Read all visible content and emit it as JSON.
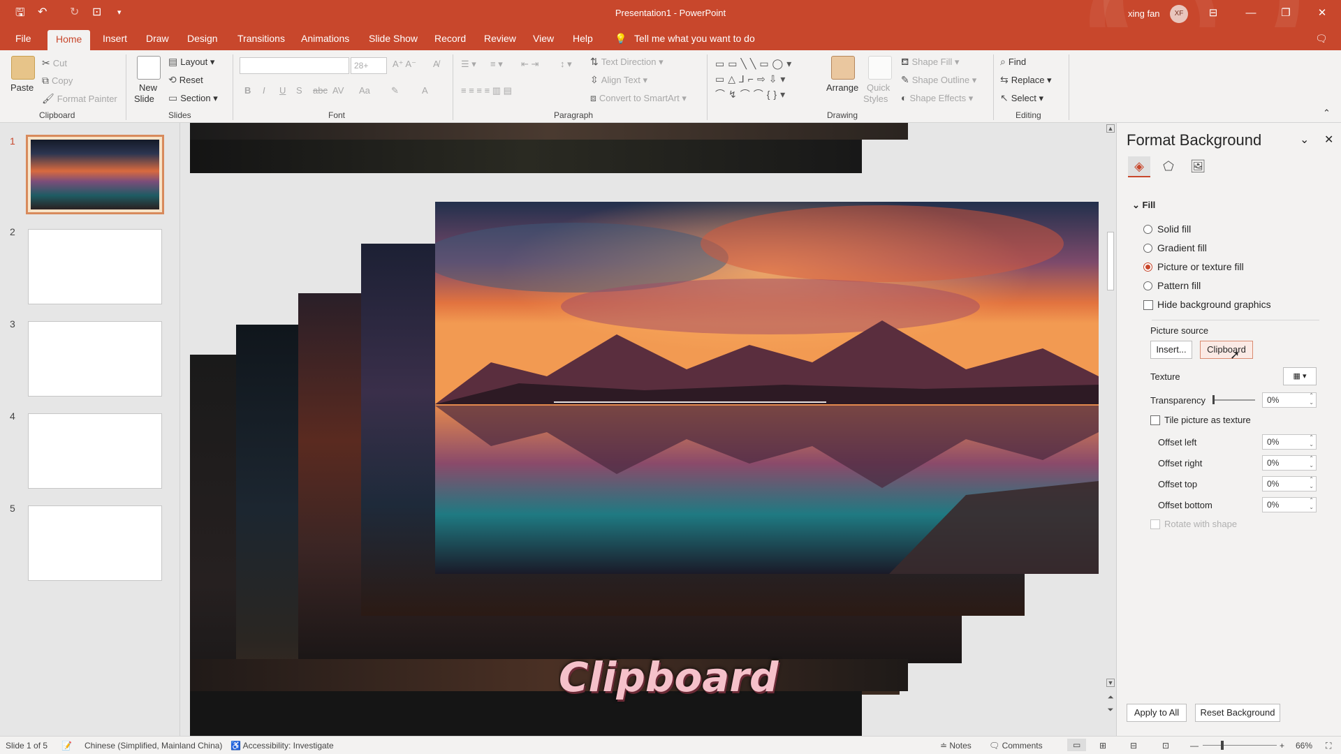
{
  "app": {
    "title": "Presentation1 - PowerPoint",
    "user_name": "xing fan",
    "user_initials": "XF"
  },
  "tabs": [
    "File",
    "Home",
    "Insert",
    "Draw",
    "Design",
    "Transitions",
    "Animations",
    "Slide Show",
    "Record",
    "Review",
    "View",
    "Help"
  ],
  "active_tab": "Home",
  "tell_me": "Tell me what you want to do",
  "ribbon": {
    "clipboard": {
      "paste": "Paste",
      "cut": "Cut",
      "copy": "Copy",
      "format_painter": "Format Painter",
      "label": "Clipboard"
    },
    "slides": {
      "new_slide_1": "New",
      "new_slide_2": "Slide",
      "layout": "Layout",
      "reset": "Reset",
      "section": "Section",
      "label": "Slides"
    },
    "font": {
      "label": "Font",
      "size": "28+"
    },
    "paragraph": {
      "text_direction": "Text Direction",
      "align_text": "Align Text",
      "convert_smartart": "Convert to SmartArt",
      "label": "Paragraph"
    },
    "drawing": {
      "arrange": "Arrange",
      "quick_1": "Quick",
      "quick_2": "Styles",
      "shape_fill": "Shape Fill",
      "shape_outline": "Shape Outline",
      "shape_effects": "Shape Effects",
      "label": "Drawing"
    },
    "editing": {
      "find": "Find",
      "replace": "Replace",
      "select": "Select",
      "label": "Editing"
    }
  },
  "slides_panel": {
    "numbers": [
      "1",
      "2",
      "3",
      "4",
      "5"
    ]
  },
  "canvas": {
    "caption": "Clipboard"
  },
  "format_background": {
    "title": "Format Background",
    "fill_section": "Fill",
    "options": [
      "Solid fill",
      "Gradient fill",
      "Picture or texture fill",
      "Pattern fill"
    ],
    "selected_option": "Picture or texture fill",
    "hide_bg_graphics": "Hide background graphics",
    "picture_source": "Picture source",
    "insert_btn": "Insert...",
    "clipboard_btn": "Clipboard",
    "texture": "Texture",
    "transparency": "Transparency",
    "transparency_value": "0%",
    "tile_picture": "Tile picture as texture",
    "offset_left": "Offset left",
    "offset_left_value": "0%",
    "offset_right": "Offset right",
    "offset_right_value": "0%",
    "offset_top": "Offset top",
    "offset_top_value": "0%",
    "offset_bottom": "Offset bottom",
    "offset_bottom_value": "0%",
    "rotate_with_shape": "Rotate with shape",
    "apply_all": "Apply to All",
    "reset_bg": "Reset Background"
  },
  "status": {
    "slide_info": "Slide 1 of 5",
    "language": "Chinese (Simplified, Mainland China)",
    "accessibility": "Accessibility: Investigate",
    "notes": "Notes",
    "comments": "Comments",
    "zoom": "66%"
  },
  "colors": {
    "accent": "#c8472c",
    "ribbon_bg": "#f3f2f1"
  }
}
